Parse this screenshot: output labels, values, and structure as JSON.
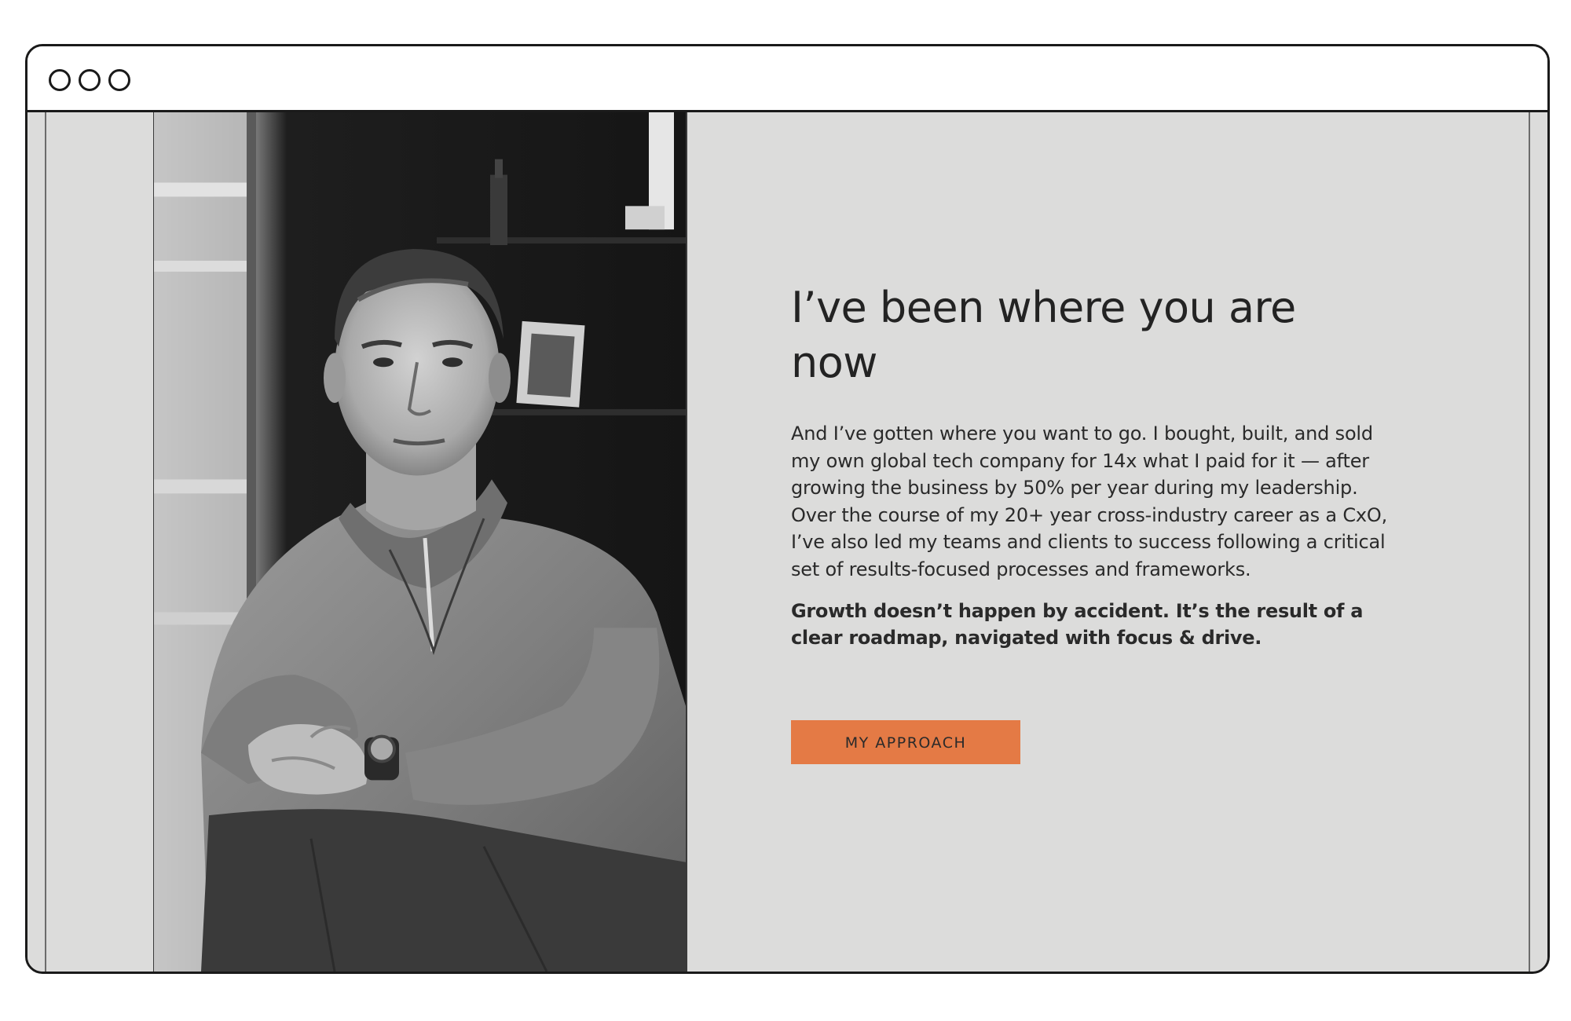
{
  "window": {
    "controls": [
      "window-dot-1",
      "window-dot-2",
      "window-dot-3"
    ]
  },
  "hero": {
    "headline": "I’ve been where you are now",
    "body": "And I’ve gotten where you want to go. I bought, built, and sold my own global tech company for 14x what I paid for it — after growing the business by 50% per year during my leadership. Over the course of my 20+ year cross-industry career as a CxO, I’ve also led my teams and clients to success following a critical set of results-focused processes and frameworks.",
    "emphasis": "Growth doesn’t happen by accident. It’s the result of a clear roadmap, navigated with focus & drive.",
    "cta_label": "MY APPROACH"
  },
  "colors": {
    "page_background": "#dcdcdb",
    "accent": "#e47a45",
    "text": "#232323"
  }
}
